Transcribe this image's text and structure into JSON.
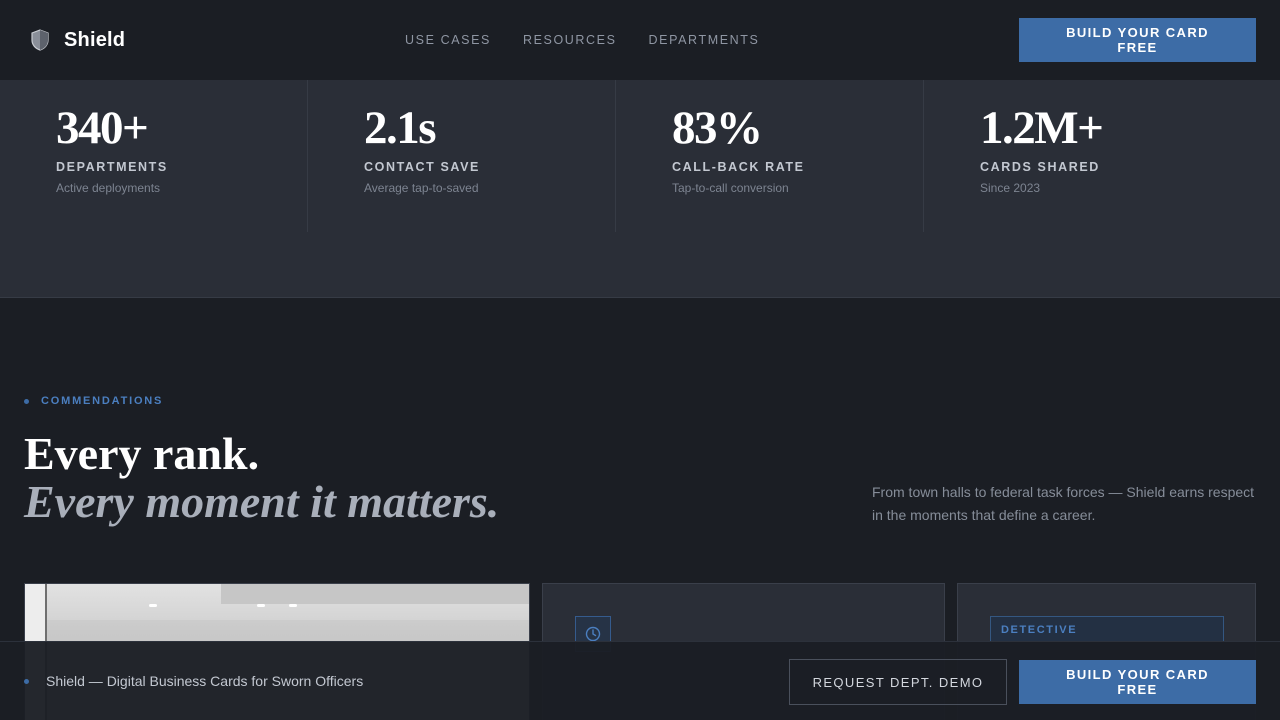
{
  "nav": {
    "brand": "Shield",
    "links": [
      "USE CASES",
      "RESOURCES",
      "DEPARTMENTS"
    ],
    "cta": "BUILD YOUR CARD FREE"
  },
  "stats": [
    {
      "value": "340+",
      "label": "DEPARTMENTS",
      "sub": "Active deployments"
    },
    {
      "value": "2.1s",
      "label": "CONTACT SAVE",
      "sub": "Average tap-to-saved"
    },
    {
      "value": "83%",
      "label": "CALL-BACK RATE",
      "sub": "Tap-to-call conversion"
    },
    {
      "value": "1.2M+",
      "label": "CARDS SHARED",
      "sub": "Since 2023"
    }
  ],
  "commendations": {
    "eyebrow": "COMMENDATIONS",
    "headline_line1": "Every rank.",
    "headline_line2": "Every moment it matters.",
    "description": "From town halls to federal task forces — Shield earns respect in the moments that define a career."
  },
  "cards": {
    "detective_badge": "DETECTIVE"
  },
  "sticky_bar": {
    "tagline": "Shield — Digital Business Cards for Sworn Officers",
    "demo_button": "REQUEST DEPT. DEMO",
    "cta": "BUILD YOUR CARD FREE"
  },
  "colors": {
    "accent": "#3d6ca6",
    "background": "#1b1e24",
    "panel": "#2a2e37"
  },
  "icons": {
    "brand": "shield-icon",
    "card_clock": "clock-icon"
  }
}
